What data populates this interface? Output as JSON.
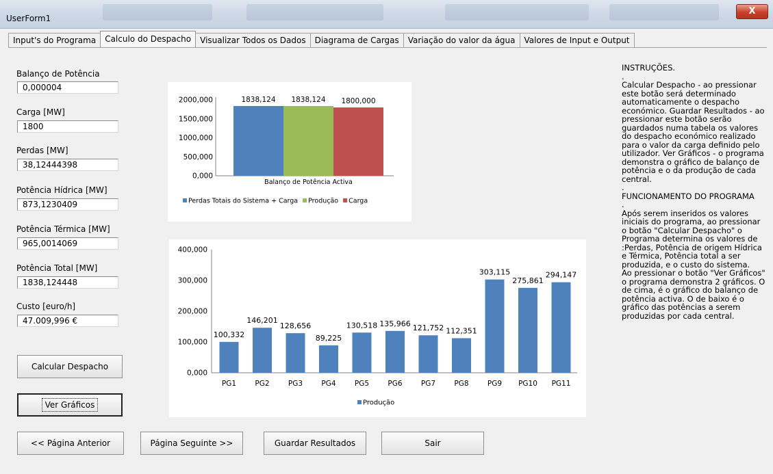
{
  "window": {
    "title": "UserForm1",
    "close_label": "X"
  },
  "tabs": [
    {
      "label": "Input's do Programa"
    },
    {
      "label": "Calculo do Despacho"
    },
    {
      "label": "Visualizar Todos os Dados"
    },
    {
      "label": "Diagrama de Cargas"
    },
    {
      "label": "Variação do valor da água"
    },
    {
      "label": "Valores de Input e Output"
    }
  ],
  "fields": {
    "balanco": {
      "label": "Balanço de Potência",
      "value": "0,000004"
    },
    "carga": {
      "label": "Carga [MW]",
      "value": "1800"
    },
    "perdas": {
      "label": "Perdas [MW]",
      "value": "38,12444398"
    },
    "hidrica": {
      "label": "Potência Hídrica [MW]",
      "value": "873,1230409"
    },
    "termica": {
      "label": "Potência Térmica [MW]",
      "value": "965,0014069"
    },
    "total": {
      "label": "Potência Total [MW]",
      "value": "1838,124448"
    },
    "custo": {
      "label": "Custo [euro/h]",
      "value": "47.009,996 €"
    }
  },
  "buttons": {
    "calcular": "Calcular Despacho",
    "ver": "Ver Gráficos",
    "anterior": "<< Página Anterior",
    "seguinte": "Página Seguinte >>",
    "guardar": "Guardar Resultados",
    "sair": "Sair"
  },
  "instructions": {
    "heading": "INSTRUÇÕES.",
    "dot1": ".",
    "body1": "Calcular Despacho - ao pressionar este botão será determinado automaticamente o despacho económico. Guardar Resultados - ao pressionar este botão serão guardados numa tabela os valores do despacho económico realizado para o valor da carga definido pelo utilizador.  Ver Gráficos - o programa demonstra o gráfico de balanço de potência e o da produção de cada central.",
    "dot2": ".",
    "heading2": "FUNCIONAMENTO DO PROGRAMA",
    "dot3": ".",
    "body2": "Após serem inseridos os valores iniciais do programa, ao pressionar o botão \"Calcular Despacho\" o Programa determina os valores de :Perdas, Potência de origem Hídrica e Térmica, Potência total a ser produzida, e o custo do sistema.\nAo pressionar o botão \"Ver Gráficos\" o programa demonstra 2 gráficos. O de cima, é o gráfico do balanço de potência activa. O de baixo é o gráfico das potências a serem produzidas por cada central."
  },
  "chart_data": [
    {
      "type": "bar",
      "categories": [
        "Balanço de Potência Activa"
      ],
      "series": [
        {
          "name": "Perdas Totais do Sistema + Carga",
          "values": [
            1838.124
          ],
          "label": "1838,124",
          "color": "#4f81bd"
        },
        {
          "name": "Produção",
          "values": [
            1838.124
          ],
          "label": "1838,124",
          "color": "#9bbb59"
        },
        {
          "name": "Carga",
          "values": [
            1800.0
          ],
          "label": "1800,000",
          "color": "#c0504d"
        }
      ],
      "ylim": [
        0,
        2000
      ],
      "yticks": [
        "0,000",
        "500,000",
        "1000,000",
        "1500,000",
        "2000,000"
      ],
      "legend": "bottom"
    },
    {
      "type": "bar",
      "categories": [
        "PG1",
        "PG2",
        "PG3",
        "PG4",
        "PG5",
        "PG6",
        "PG7",
        "PG8",
        "PG9",
        "PG10",
        "PG11"
      ],
      "series": [
        {
          "name": "Produção",
          "color": "#4f81bd",
          "values": [
            100.332,
            146.201,
            128.656,
            89.225,
            130.518,
            135.966,
            121.752,
            112.351,
            303.115,
            275.861,
            294.147
          ],
          "labels": [
            "100,332",
            "146,201",
            "128,656",
            "89,225",
            "130,518",
            "135,966",
            "121,752",
            "112,351",
            "303,115",
            "275,861",
            "294,147"
          ]
        }
      ],
      "ylim": [
        0,
        400
      ],
      "yticks": [
        "0,000",
        "100,000",
        "200,000",
        "300,000",
        "400,000"
      ],
      "legend": "bottom"
    }
  ]
}
